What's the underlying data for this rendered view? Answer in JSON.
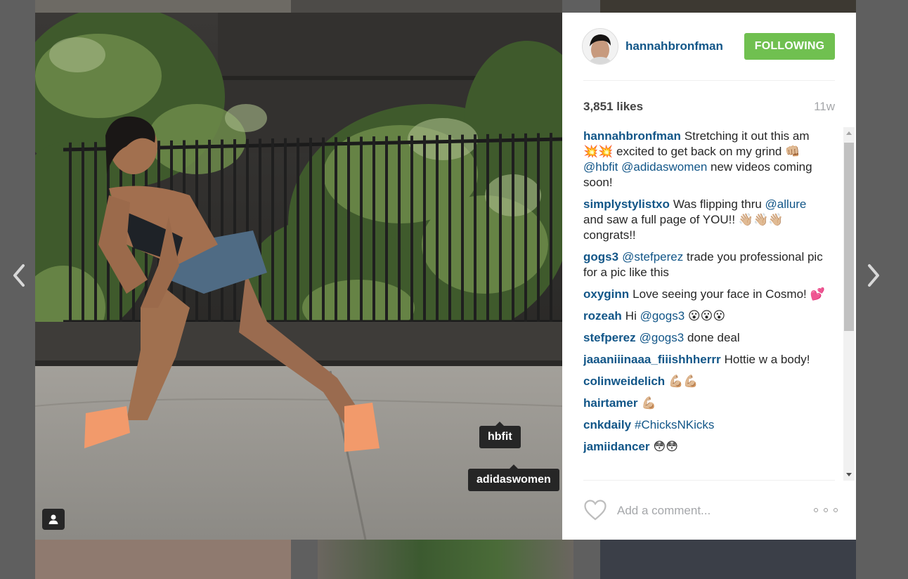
{
  "post": {
    "username": "hannahbronfman",
    "follow_label": "FOLLOWING",
    "likes": "3,851 likes",
    "age": "11w",
    "comment_placeholder": "Add a comment...",
    "photo_tags": [
      "hbfit",
      "adidaswomen"
    ]
  },
  "comments": [
    {
      "user": "hannahbronfman",
      "parts": [
        {
          "t": "Stretching it out this am 💥💥 excited to get back on my grind 👊🏼 "
        },
        {
          "m": "@hbfit"
        },
        {
          "t": " "
        },
        {
          "m": "@adidaswomen"
        },
        {
          "t": " new videos coming soon!"
        }
      ]
    },
    {
      "user": "simplystylistxo",
      "parts": [
        {
          "t": "Was flipping thru "
        },
        {
          "m": "@allure"
        },
        {
          "t": " and saw a full page of YOU!! 👋🏼👋🏼👋🏼 congrats!!"
        }
      ]
    },
    {
      "user": "gogs3",
      "parts": [
        {
          "m": "@stefperez"
        },
        {
          "t": " trade you professional pic for a pic like this"
        }
      ]
    },
    {
      "user": "oxyginn",
      "parts": [
        {
          "t": "Love seeing your face in Cosmo! 💕"
        }
      ]
    },
    {
      "user": "rozeah",
      "parts": [
        {
          "t": "Hi "
        },
        {
          "m": "@gogs3"
        },
        {
          "t": " 😮😮😮"
        }
      ]
    },
    {
      "user": "stefperez",
      "parts": [
        {
          "m": "@gogs3"
        },
        {
          "t": " done deal"
        }
      ]
    },
    {
      "user": "jaaaniiinaaa_fiiishhherrr",
      "parts": [
        {
          "t": "Hottie w a body!"
        }
      ]
    },
    {
      "user": "colinweidelich",
      "parts": [
        {
          "t": "💪🏼💪🏼"
        }
      ]
    },
    {
      "user": "hairtamer",
      "parts": [
        {
          "t": "💪🏼"
        }
      ]
    },
    {
      "user": "cnkdaily",
      "parts": [
        {
          "m": "#ChicksNKicks"
        }
      ]
    },
    {
      "user": "jamiidancer",
      "parts": [
        {
          "t": "😳😳"
        }
      ]
    }
  ],
  "icons": {
    "prev": "chevron-left-icon",
    "next": "chevron-right-icon",
    "tagged_people": "user-tag-icon",
    "like": "heart-icon",
    "more": "ellipsis-icon"
  },
  "colors": {
    "link": "#125688",
    "follow_green": "#70c050",
    "overlay": "#5f5f5f"
  }
}
